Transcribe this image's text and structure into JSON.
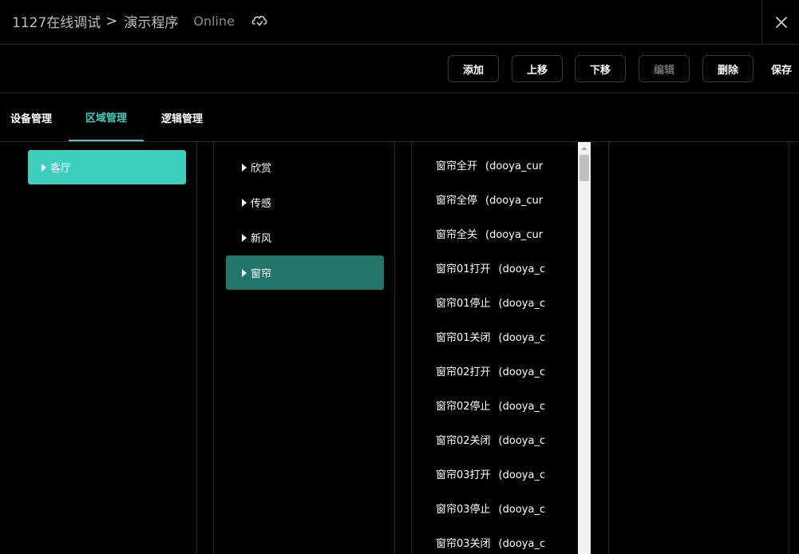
{
  "header": {
    "project": "1127在线调试",
    "separator": ">",
    "program": "演示程序",
    "status": "Online",
    "icons": {
      "cloud": "cloud-sync-icon",
      "close": "close-icon"
    }
  },
  "toolbar": {
    "add": "添加",
    "move_up": "上移",
    "move_down": "下移",
    "edit": "编辑",
    "delete": "删除",
    "save": "保存"
  },
  "tabs": [
    {
      "label": "设备管理"
    },
    {
      "label": "区域管理",
      "active": true
    },
    {
      "label": "逻辑管理"
    }
  ],
  "areas": [
    {
      "label": "客厅",
      "selected": true
    }
  ],
  "devices": [
    {
      "label": "欣赏"
    },
    {
      "label": "传感"
    },
    {
      "label": "新风"
    },
    {
      "label": "窗帘",
      "selected": true
    }
  ],
  "scenes": [
    {
      "name": "窗帘全开",
      "code": "(dooya_cur"
    },
    {
      "name": "窗帘全停",
      "code": "(dooya_cur"
    },
    {
      "name": "窗帘全关",
      "code": "(dooya_cur"
    },
    {
      "name": "窗帘01打开",
      "code": "(dooya_c"
    },
    {
      "name": "窗帘01停止",
      "code": "(dooya_c"
    },
    {
      "name": "窗帘01关闭",
      "code": "(dooya_c"
    },
    {
      "name": "窗帘02打开",
      "code": "(dooya_c"
    },
    {
      "name": "窗帘02停止",
      "code": "(dooya_c"
    },
    {
      "name": "窗帘02关闭",
      "code": "(dooya_c"
    },
    {
      "name": "窗帘03打开",
      "code": "(dooya_c"
    },
    {
      "name": "窗帘03停止",
      "code": "(dooya_c"
    },
    {
      "name": "窗帘03关闭",
      "code": "(dooya_c"
    }
  ],
  "colors": {
    "accent": "#3ecfbf",
    "selected_dark": "#23766c",
    "background": "#000000"
  }
}
